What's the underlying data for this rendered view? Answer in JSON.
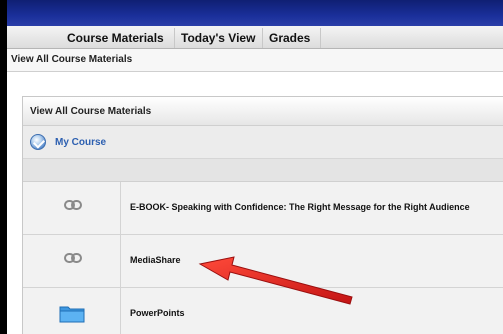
{
  "tabs": [
    {
      "label": "Course Materials"
    },
    {
      "label": "Today's View"
    },
    {
      "label": "Grades"
    }
  ],
  "breadcrumb": "View All Course Materials",
  "panel": {
    "title": "View All Course Materials",
    "course_label": "My Course"
  },
  "items": [
    {
      "label": "E-BOOK- Speaking with Confidence: The Right Message for the Right Audience",
      "icon": "link-icon"
    },
    {
      "label": "MediaShare",
      "icon": "link-icon"
    },
    {
      "label": "PowerPoints",
      "icon": "folder-icon"
    }
  ],
  "colors": {
    "topbar": "#1a2f9a",
    "accent_link": "#2c5fb0",
    "arrow": "#e01e1e"
  }
}
